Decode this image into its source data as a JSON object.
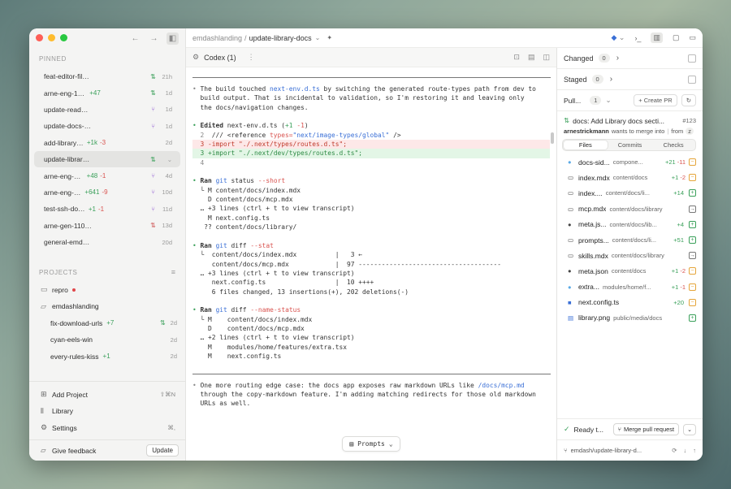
{
  "sidebar": {
    "pinned_label": "PINNED",
    "pinned": [
      {
        "name": "feat-editor-file-folders-copy-p...",
        "add": "",
        "del": "",
        "branch": "⇅",
        "branch_color": "green",
        "age": "21h"
      },
      {
        "name": "arne-eng-1310-add-a...",
        "add": "+47",
        "del": "",
        "branch": "⇅",
        "branch_color": "green",
        "age": "1d"
      },
      {
        "name": "update-readme-asana",
        "add": "",
        "del": "",
        "branch": "⑂",
        "branch_color": "purple",
        "age": "1d"
      },
      {
        "name": "update-docs-asana-integration",
        "add": "",
        "del": "",
        "branch": "⑂",
        "branch_color": "purple",
        "age": "1d"
      },
      {
        "name": "add-library-docs",
        "add": "+1k",
        "del": "-3",
        "branch": "",
        "branch_color": "",
        "age": "2d"
      },
      {
        "name": "update-library-docs",
        "add": "",
        "del": "",
        "branch": "⇅",
        "branch_color": "green",
        "age": "⌄"
      },
      {
        "name": "arne-eng-972-allow-cu...",
        "add": "+48",
        "del": "-1",
        "branch": "⑂",
        "branch_color": "purple",
        "age": "4d"
      },
      {
        "name": "arne-eng-1077-render-...",
        "add": "+641",
        "del": "-9",
        "branch": "⑂",
        "branch_color": "purple",
        "age": "10d"
      },
      {
        "name": "test-ssh-docker",
        "add": "+1",
        "del": "-1",
        "branch": "⑂",
        "branch_color": "purple",
        "age": "11d"
      },
      {
        "name": "arne-gen-1101-allow-closing-s...",
        "add": "",
        "del": "",
        "branch": "⇅",
        "branch_color": "red",
        "age": "13d"
      },
      {
        "name": "general-emdash",
        "add": "",
        "del": "",
        "branch": "",
        "branch_color": "",
        "age": "20d"
      }
    ],
    "projects_label": "PROJECTS",
    "projects": [
      {
        "name": "repro"
      },
      {
        "name": "emdashlanding"
      }
    ],
    "subtasks": [
      {
        "name": "fix-download-urls",
        "add": "+7",
        "branch": "⇅",
        "age": "2d"
      },
      {
        "name": "cyan-eels-win",
        "add": "",
        "branch": "",
        "age": "2d"
      },
      {
        "name": "every-rules-kiss",
        "add": "+1",
        "branch": "",
        "age": "2d"
      }
    ],
    "nav": {
      "add_project": "Add Project",
      "add_project_kbd": "⇧⌘N",
      "library": "Library",
      "settings": "Settings",
      "settings_kbd": "⌘,"
    },
    "feedback": "Give feedback",
    "update": "Update"
  },
  "header": {
    "project": "emdashlanding",
    "sep": "/",
    "task": "update-library-docs"
  },
  "tab": {
    "label": "Codex (1)"
  },
  "transcript": {
    "p1_a": "The build touched ",
    "p1_file": "next-env.d.ts",
    "p1_b": " by switching the generated route-types path from dev to",
    "p1_c": "build output. That is incidental to validation, so I'm restoring it and leaving only",
    "p1_d": "the docs/navigation changes.",
    "edited": "Edited",
    "edited_file": " next-env.d.ts (",
    "edited_plus": "+1",
    "edited_minus": "-1",
    "edited_close": ")",
    "d1_num": "  2  ",
    "d1_a": "/// <reference ",
    "d1_b": "types=",
    "d1_c": "\"next/image-types/global\"",
    "d1_d": " />",
    "d2": "  3 -import \"./.next/types/routes.d.ts\";",
    "d3": "  3 +import \"./.next/dev/types/routes.d.ts\";",
    "d4": "  4",
    "ran": "Ran",
    "cmd1": " git ",
    "cmd1_a": "status ",
    "cmd1_b": "--short",
    "o1_1": "  └ M content/docs/index.mdx",
    "o1_2": "    D content/docs/mcp.mdx",
    "o1_3": "  … +3 lines (ctrl + t to view transcript)",
    "o1_4": "    M next.config.ts",
    "o1_5": "   ?? content/docs/library/",
    "cmd2_a": "diff ",
    "cmd2_b": "--stat",
    "o2_1": "  └  content/docs/index.mdx          |   3 ←",
    "o2_2": "     content/docs/mcp.mdx            |  97 -------------------------------------",
    "o2_3": "  … +3 lines (ctrl + t to view transcript)",
    "o2_4": "     next.config.ts                  |  10 ++++",
    "o2_5": "     6 files changed, 13 insertions(+), 202 deletions(-)",
    "cmd3_a": "diff ",
    "cmd3_b": "--name-status",
    "o3_1": "  └ M    content/docs/index.mdx",
    "o3_2": "    D    content/docs/mcp.mdx",
    "o3_3": "  … +2 lines (ctrl + t to view transcript)",
    "o3_4": "    M    modules/home/features/extra.tsx",
    "o3_5": "    M    next.config.ts",
    "p2_a": "One more routing edge case: the docs app exposes raw markdown URLs like ",
    "p2_url": "/docs/mcp.md",
    "p2_b": "through the copy-markdown feature. I'm adding matching redirects for those old markdown",
    "p2_c": "URLs as well.",
    "prompts": "Prompts"
  },
  "right": {
    "changed": "Changed",
    "changed_count": "0",
    "staged": "Staged",
    "staged_count": "0",
    "pull": "Pull...",
    "pull_count": "1",
    "create_pr": "Create PR",
    "pr_title": "docs: Add Library docs secti...",
    "pr_number": "#123",
    "pr_author": "arnestrickmann",
    "pr_wants": "wants to merge into",
    "pr_from": "from",
    "pr_from_badge": "z",
    "tabs": [
      "Files",
      "Commits",
      "Checks"
    ],
    "files": [
      {
        "icon": "●",
        "icon_color": "#5aa9e6",
        "name": "docs-sid...",
        "path": "compone...",
        "add": "+21",
        "del": "-11",
        "status": "mod"
      },
      {
        "icon": "▭",
        "icon_color": "#444",
        "name": "index.mdx",
        "path": "content/docs",
        "add": "+1",
        "del": "-2",
        "status": "mod"
      },
      {
        "icon": "▭",
        "icon_color": "#444",
        "name": "index....",
        "path": "content/docs/li...",
        "add": "+14",
        "del": "",
        "status": "add"
      },
      {
        "icon": "▭",
        "icon_color": "#444",
        "name": "mcp.mdx",
        "path": "content/docs/library",
        "add": "",
        "del": "",
        "status": "ren"
      },
      {
        "icon": "●",
        "icon_color": "#444",
        "name": "meta.js...",
        "path": "content/docs/lib...",
        "add": "+4",
        "del": "",
        "status": "add"
      },
      {
        "icon": "▭",
        "icon_color": "#444",
        "name": "prompts...",
        "path": "content/docs/li...",
        "add": "+51",
        "del": "",
        "status": "add"
      },
      {
        "icon": "▭",
        "icon_color": "#444",
        "name": "skills.mdx",
        "path": "content/docs/library",
        "add": "",
        "del": "",
        "status": "ren"
      },
      {
        "icon": "●",
        "icon_color": "#444",
        "name": "meta.json",
        "path": "content/docs",
        "add": "+1",
        "del": "-2",
        "status": "mod"
      },
      {
        "icon": "●",
        "icon_color": "#5aa9e6",
        "name": "extra...",
        "path": "modules/home/f...",
        "add": "+1",
        "del": "-1",
        "status": "mod"
      },
      {
        "icon": "■",
        "icon_color": "#3a6fd6",
        "name": "next.config.ts",
        "path": "",
        "add": "+20",
        "del": "",
        "status": "mod"
      },
      {
        "icon": "▤",
        "icon_color": "#3a6fd6",
        "name": "library.png",
        "path": "public/media/docs",
        "add": "",
        "del": "",
        "status": "add"
      }
    ],
    "ready": "Ready t...",
    "merge": "Merge pull request",
    "branch": "emdash/update-library-d..."
  },
  "colors": {
    "accent_green": "#3aa05a",
    "accent_red": "#d9534f",
    "accent_blue": "#3a6fd6",
    "purple": "#9b6ad6"
  }
}
